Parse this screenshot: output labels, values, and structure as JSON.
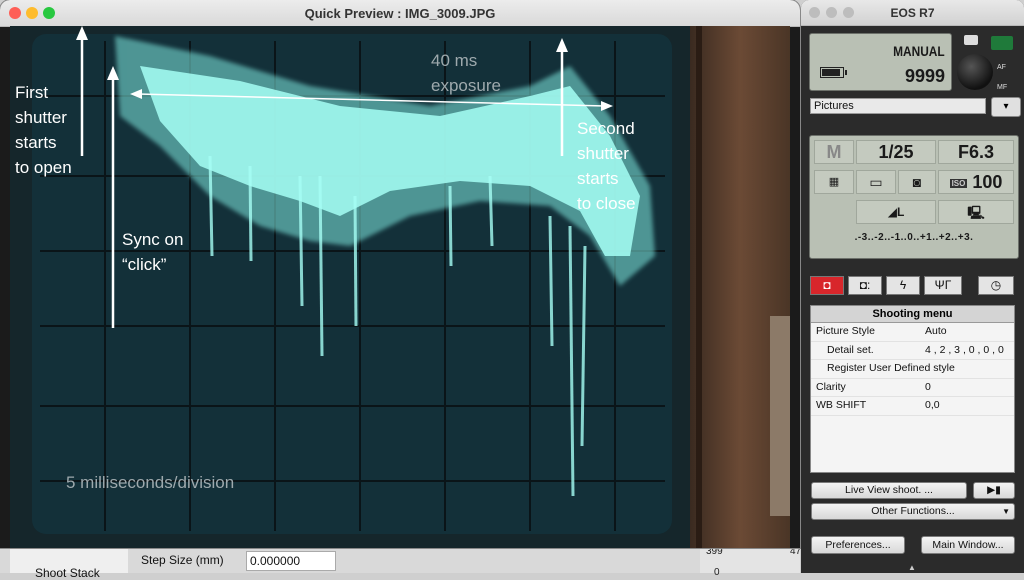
{
  "preview_window": {
    "title": "Quick Preview : IMG_3009.JPG",
    "annotations": {
      "first_shutter": "First\nshutter\nstarts\nto open",
      "sync": "Sync on\n“click”",
      "exposure": "40 ms\nexposure",
      "second_shutter": "Second\nshutter\nstarts\nto close",
      "timebase": "5 milliseconds/division"
    }
  },
  "background_app": {
    "step_size_label": "Step Size (mm)",
    "step_size_value": "0.000000",
    "shoot_stack_label": "Shoot Stack",
    "right_value_1": "399",
    "right_value_2": "47",
    "right_value_3": "0"
  },
  "camera_panel": {
    "title": "EOS R7",
    "mode": "MANUAL",
    "shots_remaining": "9999",
    "af_label": "AF",
    "mf_label": "MF",
    "folder": "Pictures",
    "shooting_mode": "M",
    "shutter_speed": "1/25",
    "aperture": "F6.3",
    "iso": "100",
    "iso_label": "ISO",
    "image_quality": "◢L",
    "exposure_scale": ".-3..-2..-1..0..+1..+2..+3.",
    "tabs": [
      "",
      "",
      "",
      "",
      ""
    ],
    "menu": {
      "header": "Shooting menu",
      "rows": [
        {
          "key": "Picture Style",
          "value": "Auto"
        },
        {
          "key": "Detail set.",
          "value": "4 , 2 , 3 , 0 , 0 , 0"
        },
        {
          "key": "Register User Defined style",
          "value": ""
        },
        {
          "key": "Clarity",
          "value": "0"
        },
        {
          "key": "WB SHIFT",
          "value": "0,0"
        }
      ]
    },
    "buttons": {
      "live_view": "Live View shoot. ...",
      "other_functions": "Other Functions...",
      "preferences": "Preferences...",
      "main_window": "Main Window..."
    }
  },
  "colors": {
    "trace": "#8ff5ee",
    "screen_bg": "#0f252d",
    "active_tab": "#d8262b"
  }
}
